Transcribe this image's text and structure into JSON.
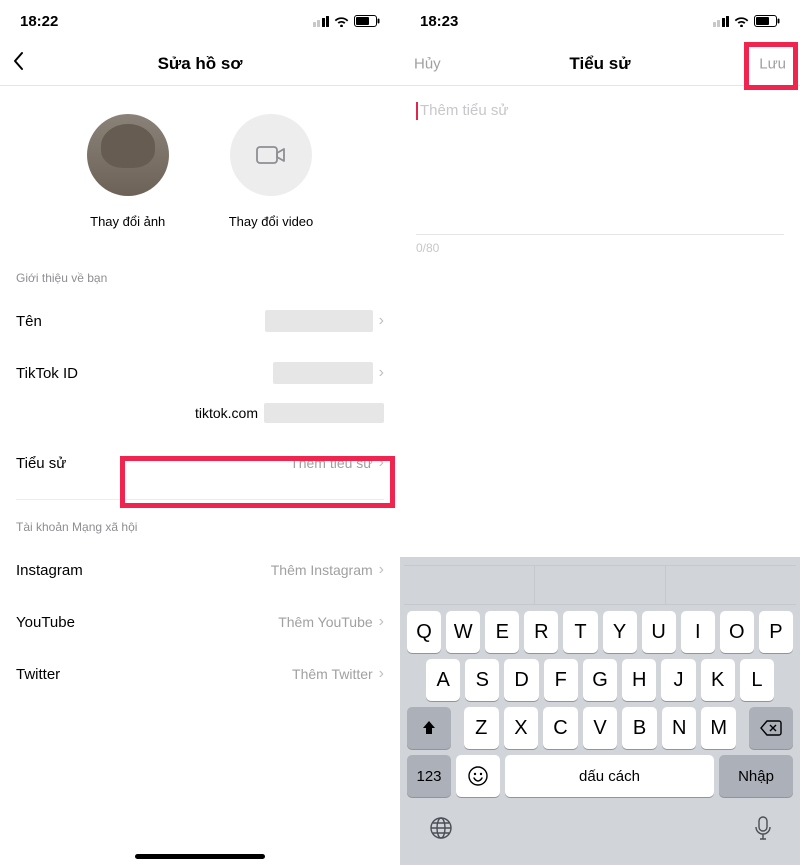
{
  "left": {
    "status_time": "18:22",
    "nav_title": "Sửa hồ sơ",
    "avatar_photo_label": "Thay đổi ảnh",
    "avatar_video_label": "Thay đổi video",
    "section_about": "Giới thiệu về bạn",
    "row_name_label": "Tên",
    "row_tiktokid_label": "TikTok ID",
    "url_prefix": "tiktok.com",
    "row_bio_label": "Tiểu sử",
    "row_bio_value": "Thêm tiểu sử",
    "section_social": "Tài khoản Mạng xã hội",
    "row_ig_label": "Instagram",
    "row_ig_value": "Thêm Instagram",
    "row_yt_label": "YouTube",
    "row_yt_value": "Thêm YouTube",
    "row_tw_label": "Twitter",
    "row_tw_value": "Thêm Twitter"
  },
  "right": {
    "status_time": "18:23",
    "nav_cancel": "Hủy",
    "nav_title": "Tiểu sử",
    "nav_save": "Lưu",
    "bio_placeholder": "Thêm tiểu sử",
    "bio_counter": "0/80",
    "keyboard": {
      "row1": [
        "Q",
        "W",
        "E",
        "R",
        "T",
        "Y",
        "U",
        "I",
        "O",
        "P"
      ],
      "row2": [
        "A",
        "S",
        "D",
        "F",
        "G",
        "H",
        "J",
        "K",
        "L"
      ],
      "row3": [
        "Z",
        "X",
        "C",
        "V",
        "B",
        "N",
        "M"
      ],
      "num_key": "123",
      "space_key": "dấu cách",
      "enter_key": "Nhập"
    }
  }
}
